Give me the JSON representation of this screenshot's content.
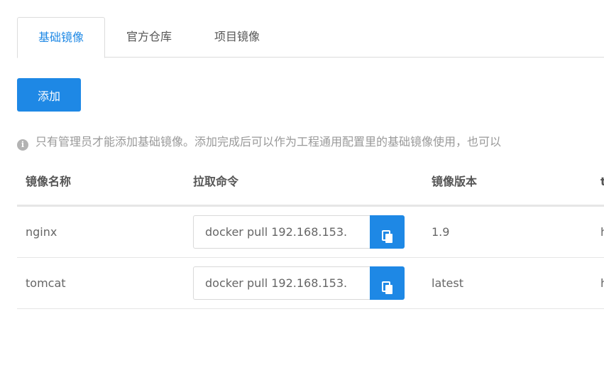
{
  "tabs": [
    {
      "label": "基础镜像",
      "active": true
    },
    {
      "label": "官方仓库",
      "active": false
    },
    {
      "label": "项目镜像",
      "active": false
    }
  ],
  "toolbar": {
    "add_label": "添加"
  },
  "notice": {
    "icon": "info-icon",
    "text": "只有管理员才能添加基础镜像。添加完成后可以作为工程通用配置里的基础镜像使用，也可以"
  },
  "table": {
    "columns": [
      "镜像名称",
      "拉取命令",
      "镜像版本",
      "t"
    ],
    "rows": [
      {
        "name": "nginx",
        "command": "docker pull 192.168.153.",
        "version": "1.9",
        "extra": "h"
      },
      {
        "name": "tomcat",
        "command": "docker pull 192.168.153.",
        "version": "latest",
        "extra": "h"
      }
    ]
  },
  "colors": {
    "accent": "#1e88e5",
    "border": "#dcdcdc",
    "muted": "#999999"
  }
}
